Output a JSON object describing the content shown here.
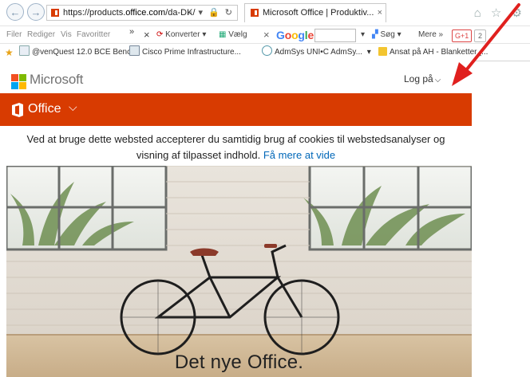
{
  "browser": {
    "url_prefix": "https://products.",
    "url_host": "office.com",
    "url_path": "/da-DK/",
    "url_tools": "⌕ ▾ 🔒 ↻",
    "tab_title": "Microsoft Office | Produktiv...",
    "tab_close": "×",
    "top_icons": "⌂ ☆ ⚙"
  },
  "favorites_bar": {
    "menu": [
      "Filer",
      "Rediger",
      "Vis",
      "Favoritter"
    ],
    "overflow": "»",
    "close": "×",
    "convert": "Konverter",
    "choose": "Vælg",
    "google_close": "×",
    "search": "Søg",
    "more": "Mere »",
    "gplus": "G+1",
    "gplus_count": "2"
  },
  "bookmarks": [
    {
      "label": "@venQuest 12.0 BCE Benc...",
      "icon": "page-icon"
    },
    {
      "label": "Cisco Prime Infrastructure...",
      "icon": "cisco-icon"
    },
    {
      "label": "AdmSys UNI•C AdmSy...",
      "icon": "network-icon"
    },
    {
      "label": "Ansat på AH - Blanketter_...",
      "icon": "folder-icon"
    }
  ],
  "header": {
    "brand": "Microsoft",
    "login": "Log på",
    "login_chevron": "⌵"
  },
  "office_bar": {
    "label": "Office",
    "chevron": "⌵",
    "color": "#d83b01"
  },
  "cookie_banner": {
    "line1": "Ved at bruge dette websted accepterer du samtidig brug af cookies til webstedsanalyser og",
    "line2": "visning af tilpasset indhold.",
    "learn_more": "Få mere at vide"
  },
  "hero": {
    "title": "Det nye Office."
  },
  "colors": {
    "office_orange": "#d83b01",
    "link_blue": "#0067b8",
    "arrow_red": "#e0201e"
  }
}
